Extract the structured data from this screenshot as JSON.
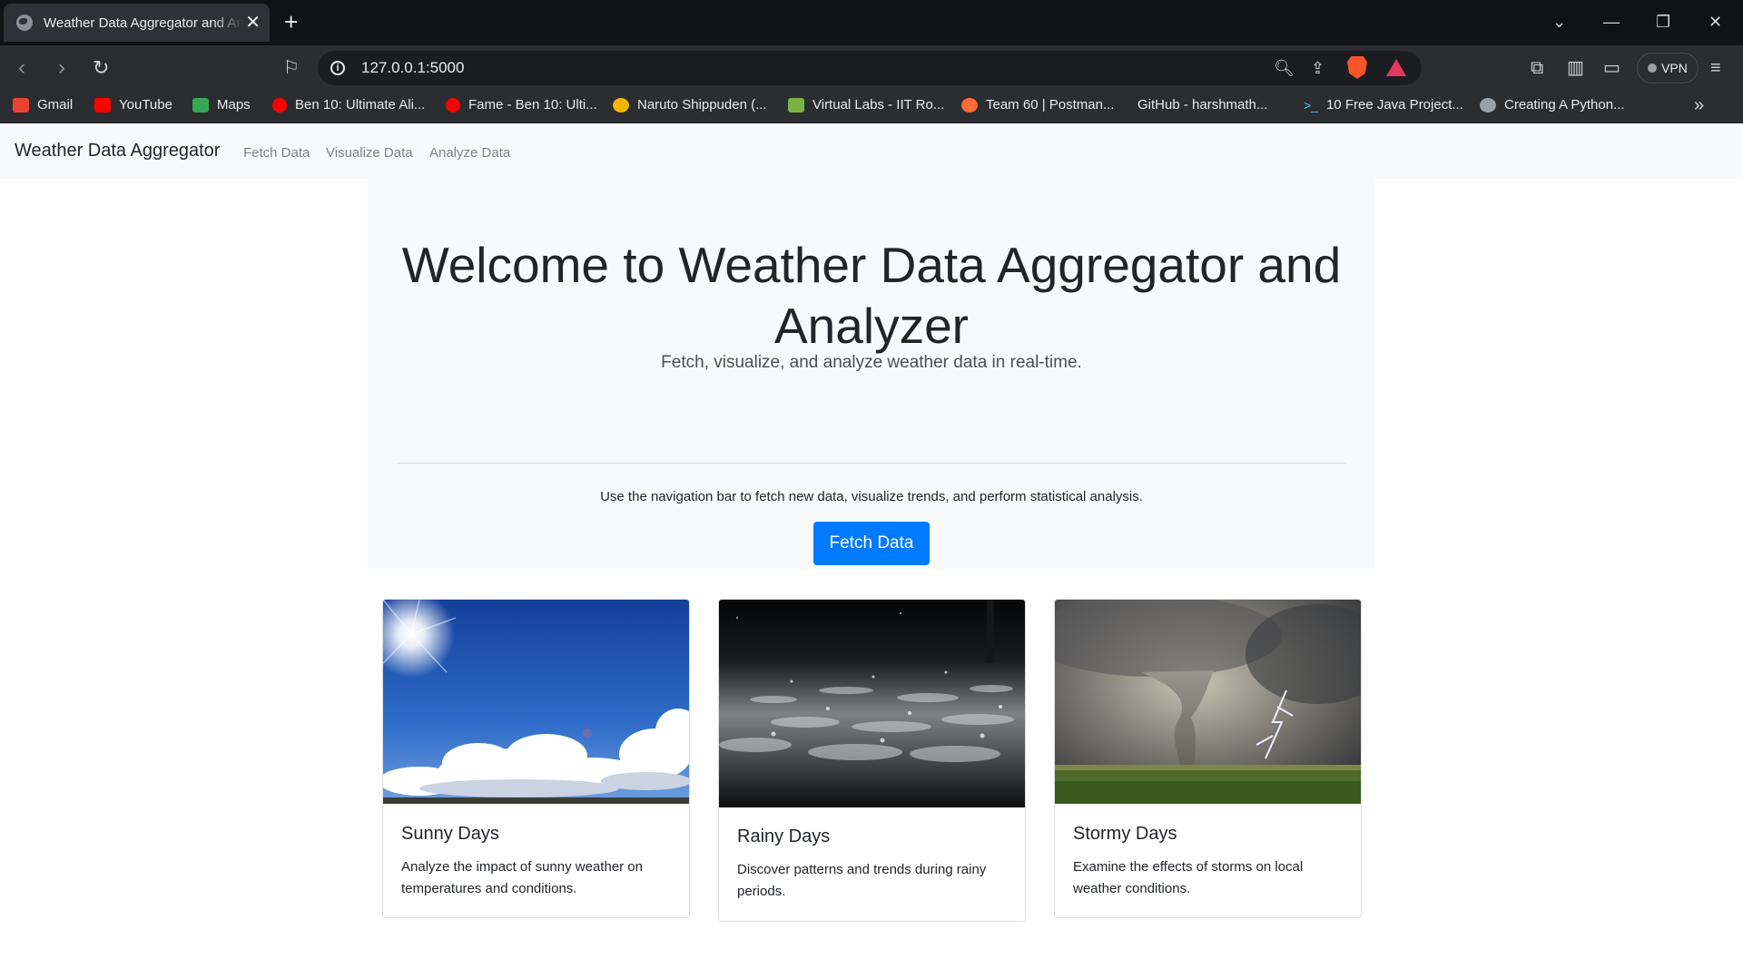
{
  "browser": {
    "tab_title": "Weather Data Aggregator and Analyzer",
    "url": "127.0.0.1:5000",
    "vpn_label": "VPN",
    "bookmarks": [
      {
        "label": "Gmail",
        "icon": "gmail-icon",
        "color": "#ea4335"
      },
      {
        "label": "YouTube",
        "icon": "youtube-icon",
        "color": "#ff0000"
      },
      {
        "label": "Maps",
        "icon": "maps-icon",
        "color": "#34a853"
      },
      {
        "label": "Ben 10: Ultimate Ali...",
        "icon": "youtube-icon",
        "color": "#ff0000"
      },
      {
        "label": "Fame - Ben 10: Ulti...",
        "icon": "youtube-icon",
        "color": "#ff0000"
      },
      {
        "label": "Naruto Shippuden (...",
        "icon": "crunchyroll-icon",
        "color": "#f4b400"
      },
      {
        "label": "Virtual Labs - IIT Ro...",
        "icon": "virtual-labs-icon",
        "color": "#7cb342"
      },
      {
        "label": "Team 60 | Postman...",
        "icon": "postman-icon",
        "color": "#ff6c37"
      },
      {
        "label": "GitHub - harshmath...",
        "icon": "github-icon",
        "color": "#2b2d31"
      },
      {
        "label": "10 Free Java Project...",
        "icon": "terminal-icon",
        "color": "#4fc3f7"
      },
      {
        "label": "Creating A Python...",
        "icon": "python-icon",
        "color": "#9aa0a6"
      }
    ]
  },
  "navbar": {
    "brand": "Weather Data Aggregator",
    "links": [
      "Fetch Data",
      "Visualize Data",
      "Analyze Data"
    ]
  },
  "hero": {
    "title": "Welcome to Weather Data Aggregator and Analyzer",
    "lead": "Fetch, visualize, and analyze weather data in real-time.",
    "text": "Use the navigation bar to fetch new data, visualize trends, and perform statistical analysis.",
    "button": "Fetch Data"
  },
  "cards": [
    {
      "title": "Sunny Days",
      "text": "Analyze the impact of sunny weather on temperatures and conditions.",
      "image": "sunny-sky-photo"
    },
    {
      "title": "Rainy Days",
      "text": "Discover patterns and trends during rainy periods.",
      "image": "rain-puddle-photo"
    },
    {
      "title": "Stormy Days",
      "text": "Examine the effects of storms on local weather conditions.",
      "image": "tornado-storm-photo"
    }
  ],
  "colors": {
    "primary": "#007bff",
    "navbar_bg": "#f8f9fa",
    "chrome_dark": "#2b2d31"
  }
}
